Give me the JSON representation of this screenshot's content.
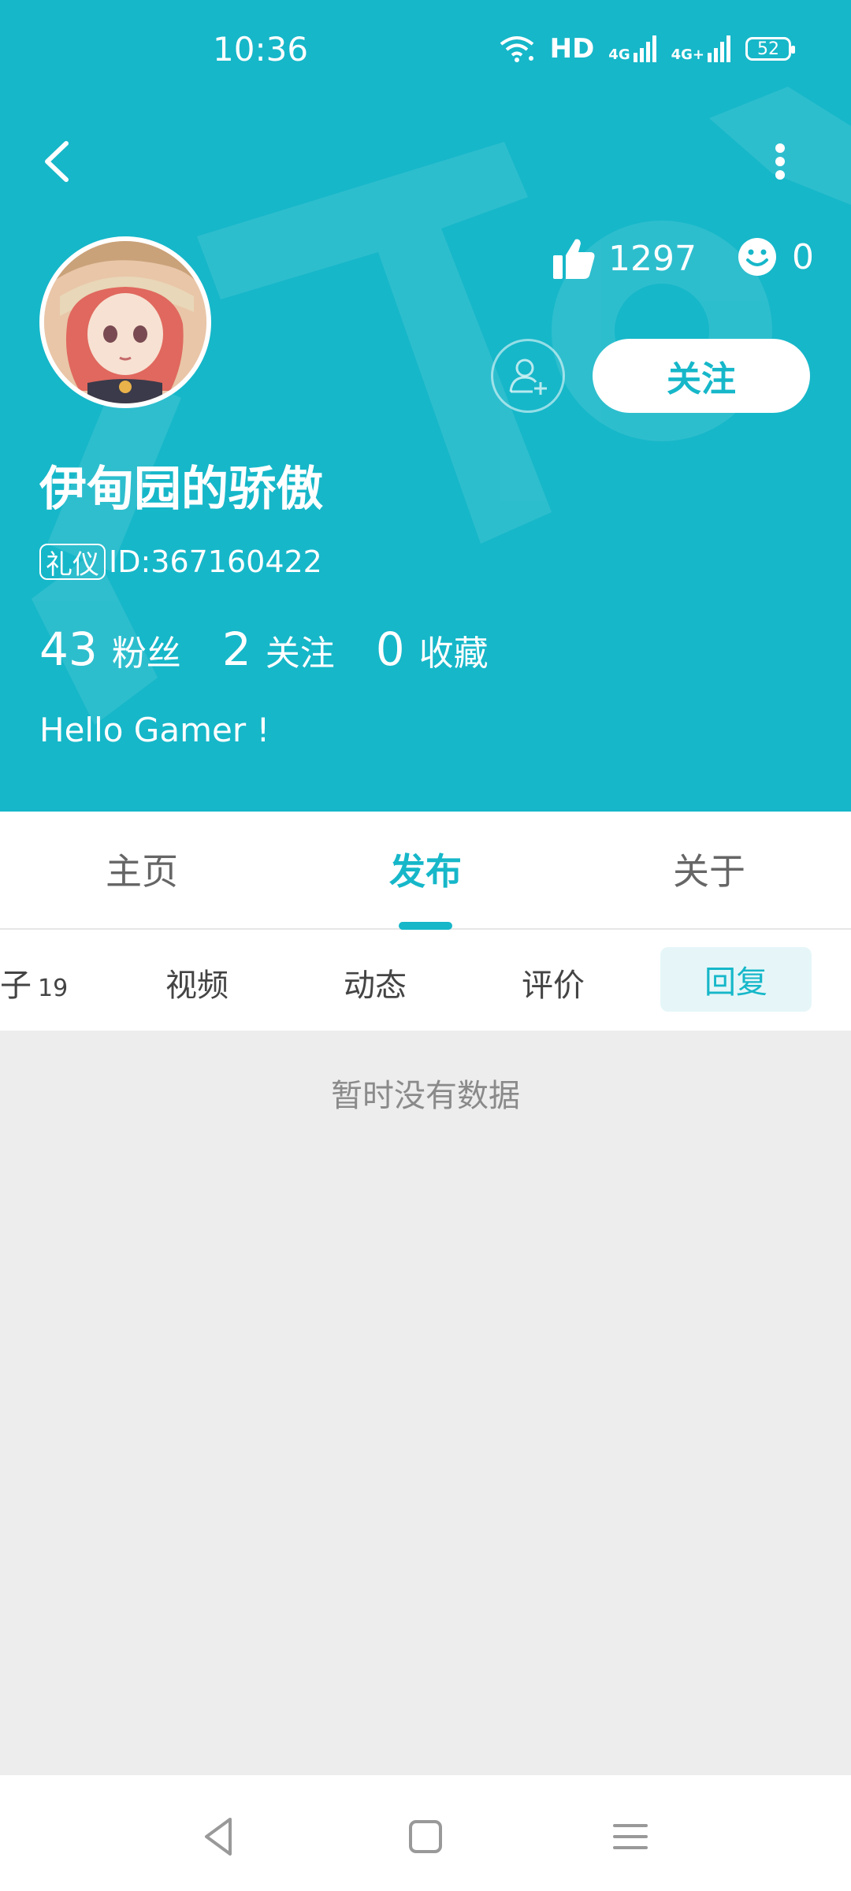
{
  "status_bar": {
    "time": "10:36",
    "hd": "HD",
    "network_1": "4G",
    "network_2": "4G+",
    "battery": "52",
    "icons": [
      "wifi-icon",
      "signal-icon",
      "battery-icon"
    ]
  },
  "header": {
    "back_icon": "back-arrow-icon",
    "more_icon": "more-vertical-icon",
    "likes_count": "1297",
    "smiles_count": "0",
    "follow_label": "关注",
    "username": "伊甸园的骄傲",
    "badge": "礼仪",
    "user_id": "ID:367160422",
    "stats": [
      {
        "num": "43",
        "label": "粉丝"
      },
      {
        "num": "2",
        "label": "关注"
      },
      {
        "num": "0",
        "label": "收藏"
      }
    ],
    "bio": "Hello Gamer !"
  },
  "main_tabs": [
    {
      "label": "主页",
      "active": false
    },
    {
      "label": "发布",
      "active": true
    },
    {
      "label": "关于",
      "active": false
    }
  ],
  "sub_tabs": [
    {
      "label": "帖子",
      "count": "19",
      "active": false
    },
    {
      "label": "视频",
      "active": false
    },
    {
      "label": "动态",
      "active": false
    },
    {
      "label": "评价",
      "active": false
    },
    {
      "label": "回复",
      "active": true
    }
  ],
  "content": {
    "empty_text": "暂时没有数据"
  },
  "nav_bar": {
    "icons": [
      "back-triangle-icon",
      "home-square-icon",
      "menu-lines-icon"
    ]
  },
  "colors": {
    "primary": "#16b7c9",
    "background": "#ededed"
  }
}
